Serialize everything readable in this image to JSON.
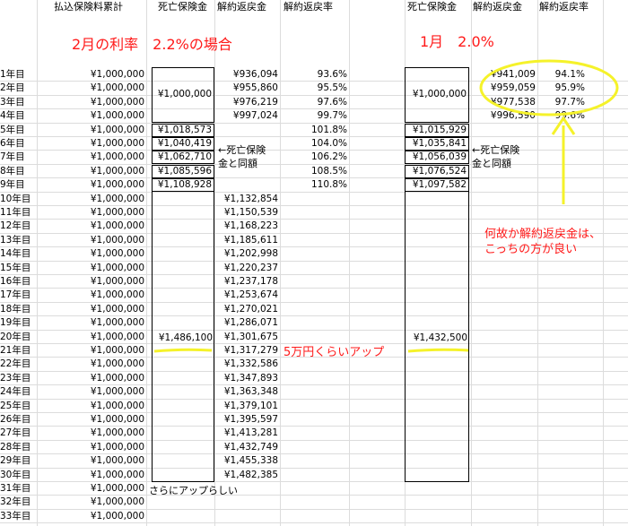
{
  "headers": {
    "paid": "払込保険料累計",
    "death1": "死亡保険金",
    "refund1": "解約返戻金",
    "rate1": "解約返戻率",
    "death2": "死亡保険金",
    "refund2": "解約返戻金",
    "rate2": "解約返戻率"
  },
  "titles": {
    "feb": "2月の利率　2.2%の場合",
    "jan": "1月　2.0%"
  },
  "years": [
    "1年目",
    "2年目",
    "3年目",
    "4年目",
    "5年目",
    "6年目",
    "7年目",
    "8年目",
    "9年目",
    "10年目",
    "11年目",
    "12年目",
    "13年目",
    "14年目",
    "15年目",
    "16年目",
    "17年目",
    "18年目",
    "19年目",
    "20年目",
    "21年目",
    "22年目",
    "23年目",
    "24年目",
    "25年目",
    "26年目",
    "27年目",
    "28年目",
    "29年目",
    "30年目",
    "31年目",
    "32年目",
    "33年目"
  ],
  "paid_value": "¥1,000,000",
  "feb": {
    "death_group1": "¥1,000,000",
    "death_steps": [
      "¥1,018,573",
      "¥1,040,419",
      "¥1,062,710",
      "¥1,085,596",
      "¥1,108,928"
    ],
    "death_group3": "¥1,486,100",
    "refund": [
      "¥936,094",
      "¥955,860",
      "¥976,219",
      "¥997,024",
      "",
      "",
      "",
      "",
      "",
      "¥1,132,854",
      "¥1,150,539",
      "¥1,168,223",
      "¥1,185,611",
      "¥1,202,998",
      "¥1,220,237",
      "¥1,237,178",
      "¥1,253,674",
      "¥1,270,021",
      "¥1,286,071",
      "¥1,301,675",
      "¥1,317,279",
      "¥1,332,586",
      "¥1,347,893",
      "¥1,363,348",
      "¥1,379,101",
      "¥1,395,597",
      "¥1,413,281",
      "¥1,432,749",
      "¥1,455,338",
      "¥1,482,385"
    ],
    "rate": [
      "93.6%",
      "95.5%",
      "97.6%",
      "99.7%",
      "101.8%",
      "104.0%",
      "106.2%",
      "108.5%",
      "110.8%"
    ]
  },
  "jan": {
    "death_group1": "¥1,000,000",
    "death_steps": [
      "¥1,015,929",
      "¥1,035,841",
      "¥1,056,039",
      "¥1,076,524",
      "¥1,097,582"
    ],
    "death_group3": "¥1,432,500",
    "refund": [
      "¥941,009",
      "¥959,059",
      "¥977,538",
      "¥996,590"
    ],
    "rate": [
      "94.1%",
      "95.9%",
      "97.7%",
      "99.6%"
    ]
  },
  "notes": {
    "same1": "←死亡保険\n金と同額",
    "same2": "←死亡保険\n金と同額",
    "more_up": "さらにアップらしい",
    "up50k": "5万円くらいアップ",
    "why": "何故か解約返戻金は、\nこっちの方が良い"
  },
  "colors": {
    "red": "#ff1a1a",
    "yellow": "#f5f22a"
  }
}
